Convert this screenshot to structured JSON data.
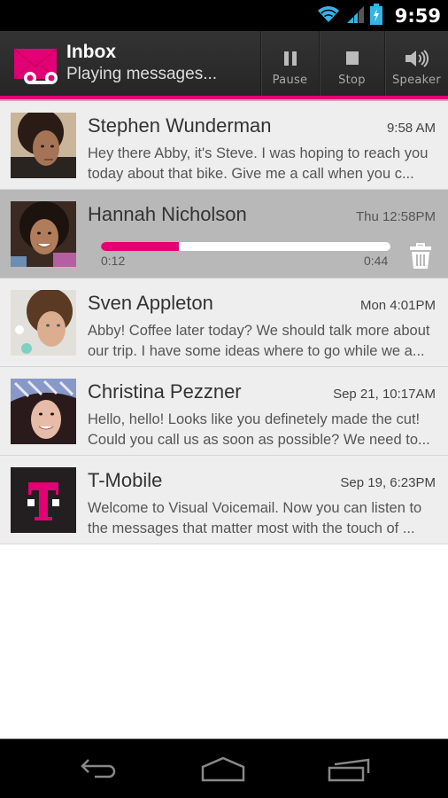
{
  "status_bar": {
    "time": "9:59",
    "icons": [
      "wifi-icon",
      "signal-icon",
      "battery-charging-icon"
    ]
  },
  "action_bar": {
    "title": "Inbox",
    "subtitle": "Playing messages...",
    "app_icon": "voicemail-envelope-icon",
    "accent_color": "#e20074",
    "actions": [
      {
        "label": "Pause",
        "icon": "pause-icon"
      },
      {
        "label": "Stop",
        "icon": "stop-icon"
      },
      {
        "label": "Speaker",
        "icon": "speaker-icon"
      }
    ]
  },
  "messages": [
    {
      "name": "Stephen Wunderman",
      "time": "9:58 AM",
      "preview_line1": "Hey there Abby, it's Steve. I was hoping to reach you",
      "preview_line2": "today about that bike. Give me a call when you c..."
    },
    {
      "name": "Hannah Nicholson",
      "time": "Thu 12:58PM",
      "playing": true,
      "position": "0:12",
      "duration": "0:44",
      "progress_fraction": 0.27
    },
    {
      "name": "Sven Appleton",
      "time": "Mon 4:01PM",
      "preview_line1": "Abby! Coffee later today? We should talk more about",
      "preview_line2": "our trip. I have some ideas where to go while we a..."
    },
    {
      "name": "Christina Pezzner",
      "time": "Sep 21, 10:17AM",
      "preview_line1": "Hello, hello! Looks like you definetely made the cut!",
      "preview_line2": "Could you call us as soon as possible? We need to..."
    },
    {
      "name": "T-Mobile",
      "time": "Sep 19, 6:23PM",
      "preview_line1": "Welcome to Visual Voicemail. Now you can listen to",
      "preview_line2": "the messages that matter most with the touch of ..."
    }
  ],
  "nav_bar": {
    "buttons": [
      "back-icon",
      "home-icon",
      "recent-apps-icon"
    ]
  }
}
